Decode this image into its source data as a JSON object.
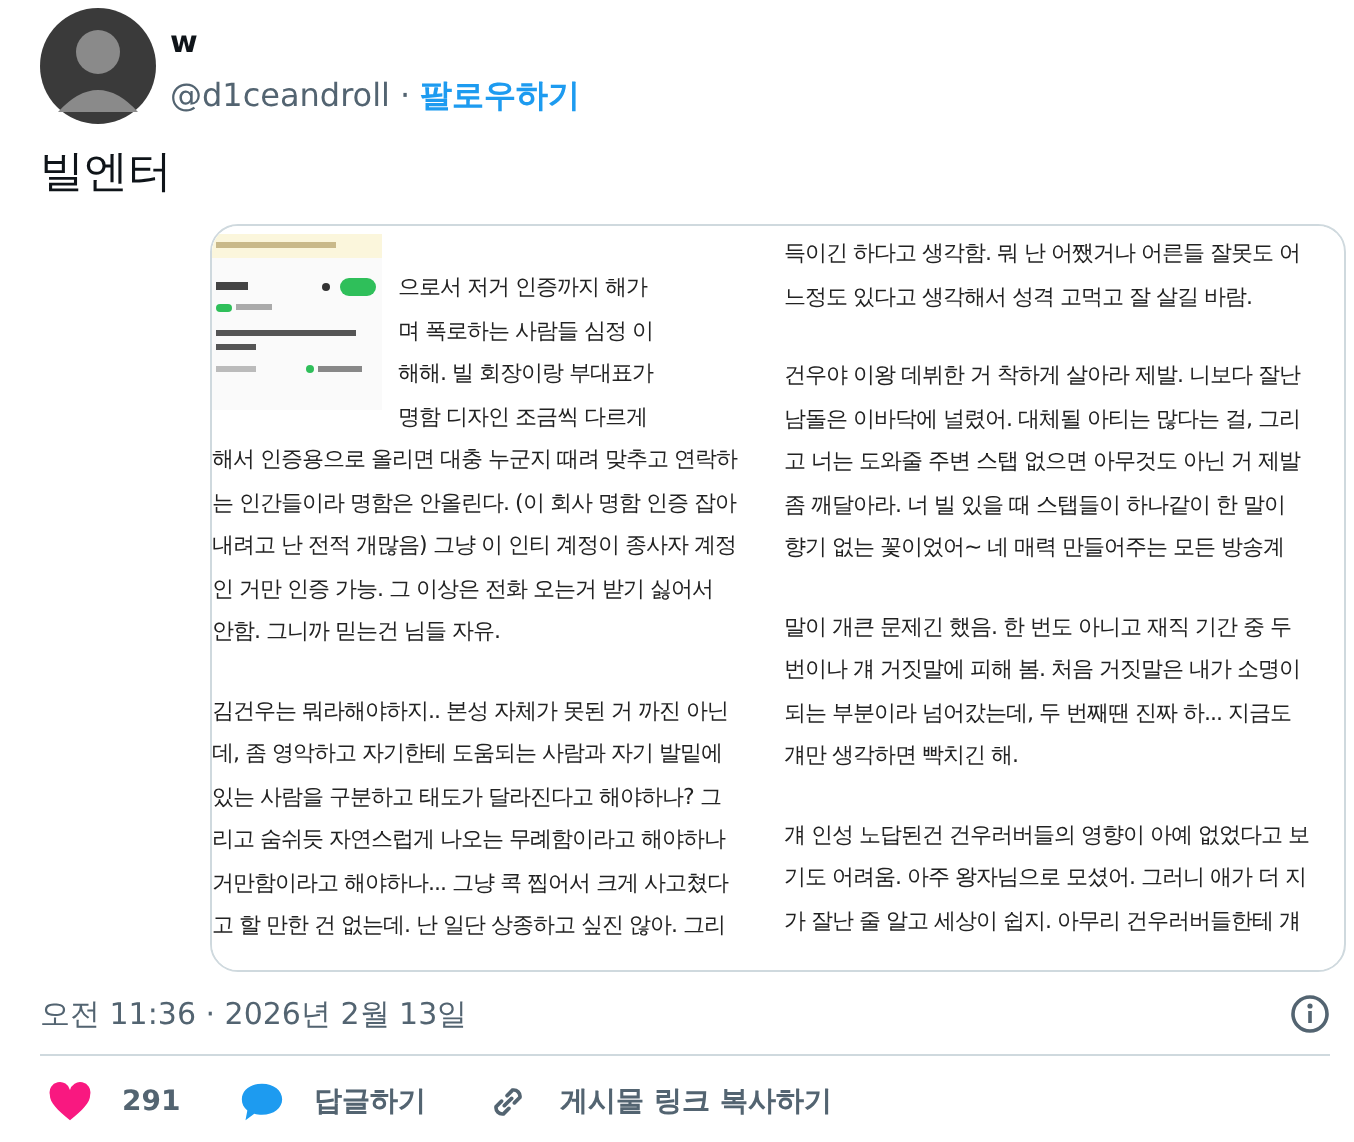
{
  "author": {
    "name": "w",
    "handle": "@d1ceandroll",
    "separator": "·",
    "follow": "팔로우하기"
  },
  "text": "빌엔터",
  "media": [
    {
      "wrapped_lines": [
        "으로서 저거 인증까지 해가",
        "며 폭로하는 사람들 심정 이",
        "해해. 빌 회장이랑 부대표가",
        "명함 디자인 조금씩 다르게"
      ],
      "paragraphs": [
        [
          "해서 인증용으로 올리면 대충 누군지 때려 맞추고 연락하",
          "는 인간들이라 명함은 안올린다. (이 회사 명함 인증 잡아",
          "내려고 난 전적 개많음) 그냥 이 인티 계정이 종사자 계정",
          "인 거만 인증 가능. 그 이상은 전화 오는거 받기 싫어서",
          "안함. 그니까 믿는건 님들 자유."
        ],
        [
          "김건우는 뭐라해야하지.. 본성 자체가 못된 거 까진 아닌",
          "데, 좀 영악하고 자기한테 도움되는 사람과 자기 발밑에",
          "있는 사람을 구분하고 태도가 달라진다고 해야하나? 그",
          "리고 숨쉬듯 자연스럽게 나오는 무례함이라고 해야하나",
          "거만함이라고 해야하나... 그냥 콕 찝어서 크게 사고쳤다",
          "고 할 만한 건 없는데. 난 일단 상종하고 싶진 않아. 그리"
        ]
      ]
    },
    {
      "paragraphs": [
        [
          "득이긴 하다고 생각함. 뭐 난 어쨌거나 어른들 잘못도 어",
          "느정도 있다고 생각해서 성격 고먹고 잘 살길 바람."
        ],
        [
          "건우야 이왕 데뷔한 거 착하게 살아라 제발. 니보다 잘난",
          "남돌은 이바닥에 널렸어. 대체될 아티는 많다는 걸, 그리",
          "고 너는 도와줄 주변 스탭 없으면 아무것도 아닌 거 제발",
          "좀 깨달아라. 너 빌 있을 때 스탭들이 하나같이 한 말이",
          "향기 없는 꽃이었어~ 네 매력 만들어주는 모든 방송계"
        ],
        [
          "말이 개큰 문제긴 했음. 한 번도 아니고 재직 기간 중 두",
          "번이나 걔 거짓말에 피해 봄. 처음 거짓말은 내가 소명이",
          "되는 부분이라 넘어갔는데, 두 번째땐 진짜 하... 지금도",
          "걔만 생각하면 빡치긴 해."
        ],
        [
          "걔 인성 노답된건 건우러버들의 영향이 아예 없었다고 보",
          "기도 어려움. 아주 왕자님으로 모셨어. 그러니 애가 더 지",
          "가 잘난 줄 알고 세상이 쉽지. 아무리 건우러버들한테 걔"
        ]
      ]
    }
  ],
  "timestamp": "오전 11:36 · 2026년 2월 13일",
  "actions": [
    {
      "kind": "like",
      "label": "291"
    },
    {
      "kind": "reply",
      "label": "답글하기"
    },
    {
      "kind": "copy-link",
      "label": "게시물 링크 복사하기"
    }
  ]
}
